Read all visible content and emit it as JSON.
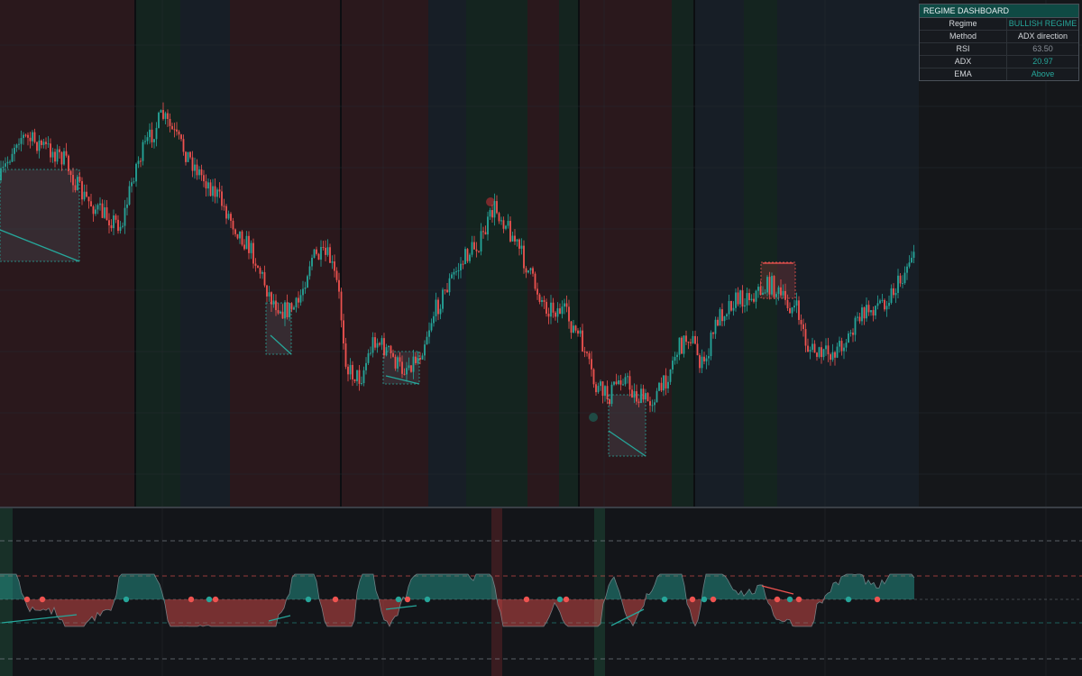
{
  "dashboard": {
    "title": "REGIME DASHBOARD",
    "rows": [
      {
        "key": "Regime",
        "value": "BULLISH REGIME"
      },
      {
        "key": "Method",
        "value": "ADX direction"
      },
      {
        "key": "RSI",
        "value": "63.50"
      },
      {
        "key": "ADX",
        "value": "20.97"
      },
      {
        "key": "EMA",
        "value": "Above"
      }
    ]
  },
  "colors": {
    "background": "#131519",
    "bull_candle": "#26a69a",
    "bear_candle": "#ef5350",
    "bear_regime_bg": "#2a181c",
    "bull_regime_bg": "#14241f",
    "neutral_regime_bg": "#171e26",
    "dashboard_header": "#0f4a44"
  }
}
